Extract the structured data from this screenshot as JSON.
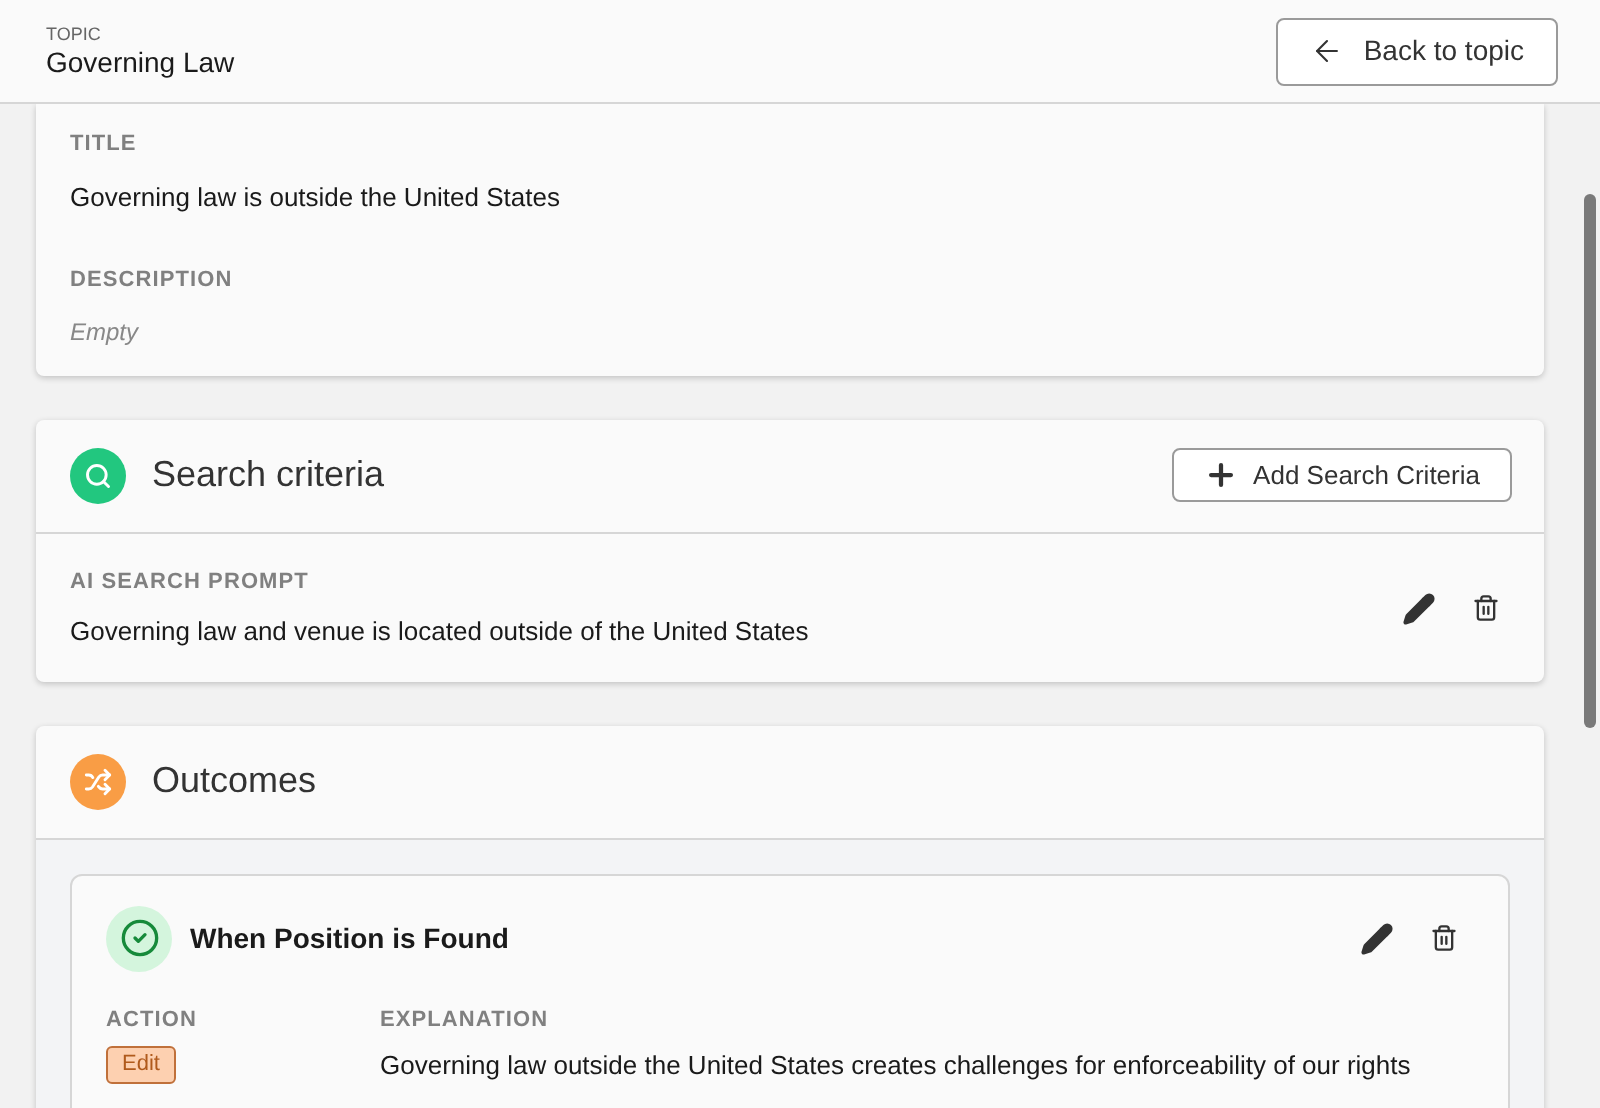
{
  "header": {
    "eyebrow": "TOPIC",
    "title": "Governing Law",
    "back_button": "Back to topic"
  },
  "details": {
    "title_label": "TITLE",
    "title_value": "Governing law is outside the United States",
    "description_label": "DESCRIPTION",
    "description_value": "Empty"
  },
  "search_criteria": {
    "heading": "Search criteria",
    "add_button": "Add Search Criteria",
    "items": [
      {
        "label": "AI SEARCH PROMPT",
        "value": "Governing law and venue is located outside of the United States"
      }
    ]
  },
  "outcomes": {
    "heading": "Outcomes",
    "items": [
      {
        "title": "When Position is Found",
        "action_label": "ACTION",
        "explanation_label": "EXPLANATION",
        "action": "Edit",
        "explanation": "Governing law outside the United States creates challenges for enforceability of our rights"
      }
    ]
  }
}
